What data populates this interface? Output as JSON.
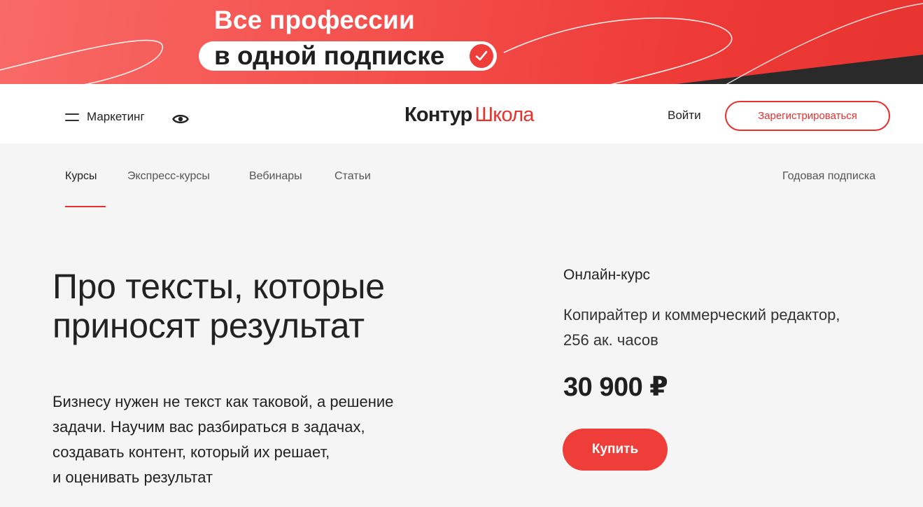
{
  "banner": {
    "title": "Все профессии",
    "subtitle": "в одной подписке",
    "check_icon": "check-circle-icon",
    "colors": {
      "accent": "#ef3e3a",
      "dark": "#2a2a2a"
    }
  },
  "header": {
    "menu_label": "Маркетинг",
    "menu_icon": "burger-icon",
    "accessibility_icon": "eye-icon",
    "logo": {
      "part1": "Контур",
      "part2": "Школа"
    },
    "login_label": "Войти",
    "register_label": "Зарегистрироваться"
  },
  "nav": {
    "items": [
      {
        "label": "Курсы",
        "active": true
      },
      {
        "label": "Экспресс-курсы",
        "active": false
      },
      {
        "label": "Вебинары",
        "active": false
      },
      {
        "label": "Статьи",
        "active": false
      }
    ],
    "right_label": "Годовая подписка"
  },
  "hero": {
    "title_line1": "Про тексты, которые",
    "title_line2": "приносят результат",
    "text_line1": "Бизнесу нужен не текст как таковой, а решение",
    "text_line2": "задачи. Научим вас разбираться в задачах,",
    "text_line3": "создавать контент, который их решает,",
    "text_line4": "и оценивать результат"
  },
  "course": {
    "type": "Онлайн-курс",
    "name_line1": "Копирайтер и коммерческий редактор,",
    "name_line2": "256 ак. часов",
    "price": "30 900 ₽",
    "buy_label": "Купить"
  },
  "colors": {
    "brand_red": "#e6322e",
    "background": "#f5f5f5"
  }
}
